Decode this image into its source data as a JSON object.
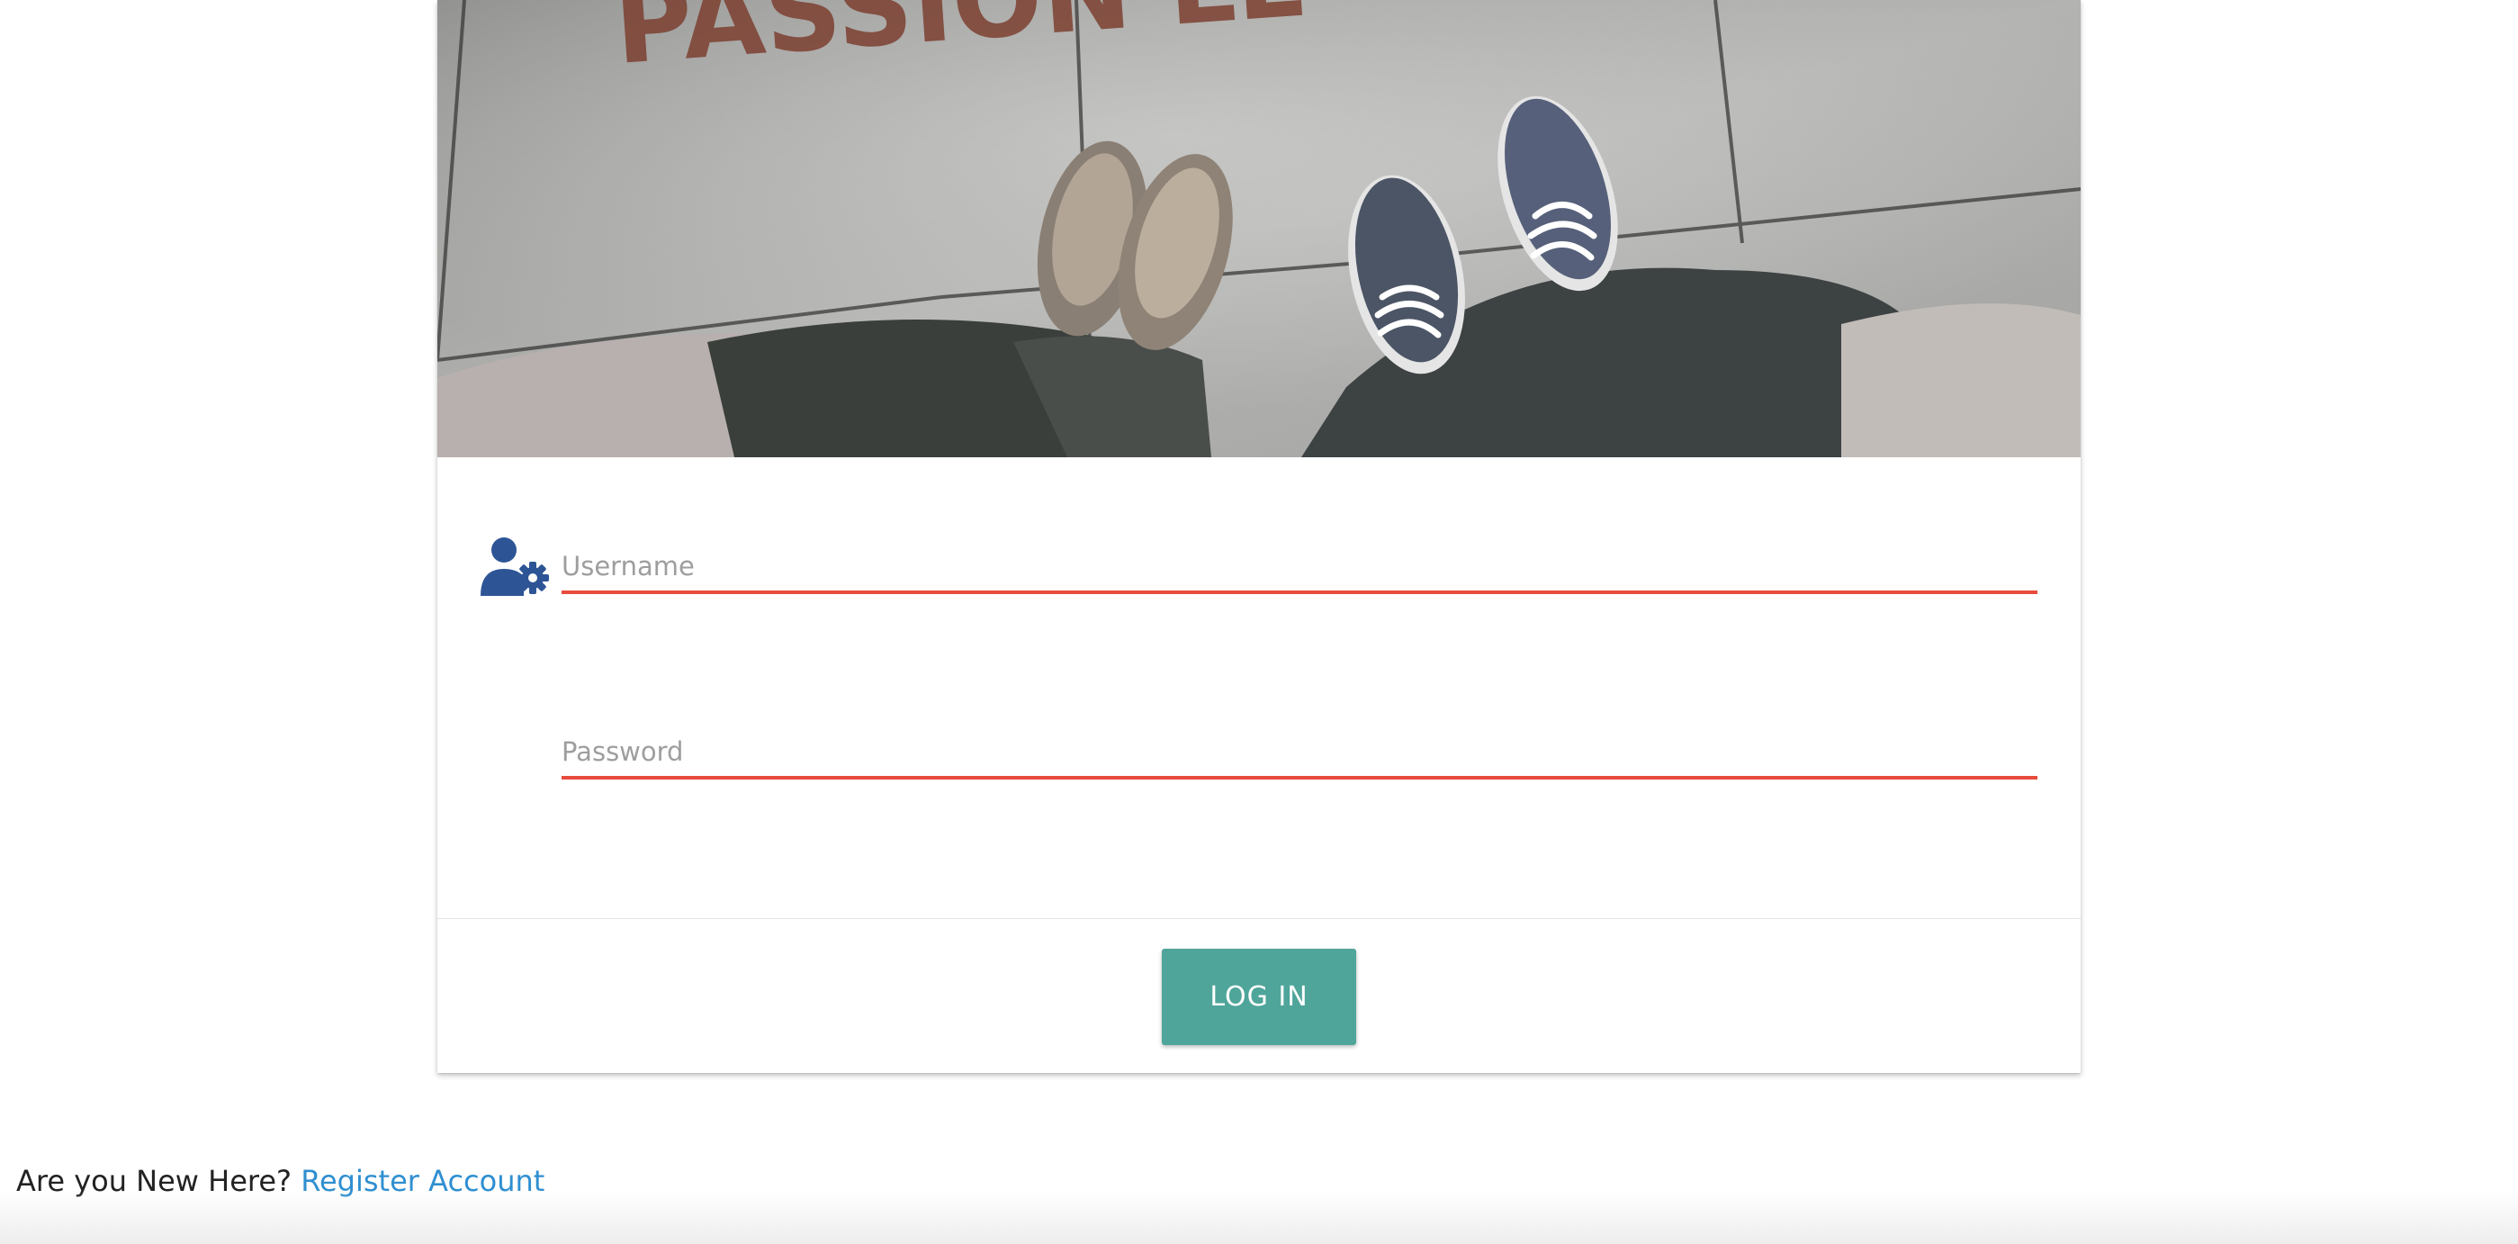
{
  "hero": {
    "image_text": "PASSION LE"
  },
  "form": {
    "username_placeholder": "Username",
    "password_placeholder": "Password",
    "icon": "user-gear-icon"
  },
  "actions": {
    "login_label": "LOG IN"
  },
  "footer": {
    "prompt": "Are you New Here?",
    "register_link": "Register Account"
  },
  "colors": {
    "accent_button": "#4fa59a",
    "field_underline": "#e74c3c",
    "icon": "#2d5596",
    "link": "#2f8fd0"
  }
}
